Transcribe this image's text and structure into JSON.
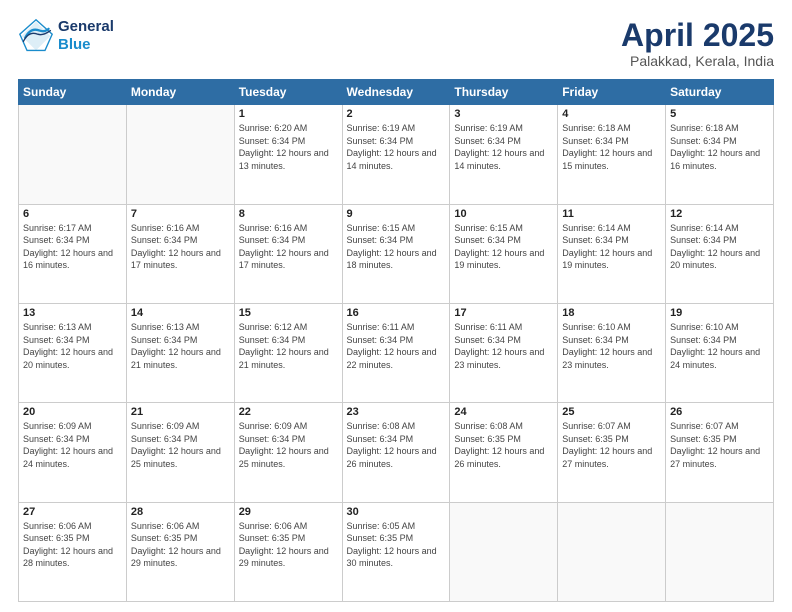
{
  "header": {
    "logo_line1": "General",
    "logo_line2": "Blue",
    "title": "April 2025",
    "subtitle": "Palakkad, Kerala, India"
  },
  "days_of_week": [
    "Sunday",
    "Monday",
    "Tuesday",
    "Wednesday",
    "Thursday",
    "Friday",
    "Saturday"
  ],
  "weeks": [
    [
      {
        "day": "",
        "info": ""
      },
      {
        "day": "",
        "info": ""
      },
      {
        "day": "1",
        "info": "Sunrise: 6:20 AM\nSunset: 6:34 PM\nDaylight: 12 hours and 13 minutes."
      },
      {
        "day": "2",
        "info": "Sunrise: 6:19 AM\nSunset: 6:34 PM\nDaylight: 12 hours and 14 minutes."
      },
      {
        "day": "3",
        "info": "Sunrise: 6:19 AM\nSunset: 6:34 PM\nDaylight: 12 hours and 14 minutes."
      },
      {
        "day": "4",
        "info": "Sunrise: 6:18 AM\nSunset: 6:34 PM\nDaylight: 12 hours and 15 minutes."
      },
      {
        "day": "5",
        "info": "Sunrise: 6:18 AM\nSunset: 6:34 PM\nDaylight: 12 hours and 16 minutes."
      }
    ],
    [
      {
        "day": "6",
        "info": "Sunrise: 6:17 AM\nSunset: 6:34 PM\nDaylight: 12 hours and 16 minutes."
      },
      {
        "day": "7",
        "info": "Sunrise: 6:16 AM\nSunset: 6:34 PM\nDaylight: 12 hours and 17 minutes."
      },
      {
        "day": "8",
        "info": "Sunrise: 6:16 AM\nSunset: 6:34 PM\nDaylight: 12 hours and 17 minutes."
      },
      {
        "day": "9",
        "info": "Sunrise: 6:15 AM\nSunset: 6:34 PM\nDaylight: 12 hours and 18 minutes."
      },
      {
        "day": "10",
        "info": "Sunrise: 6:15 AM\nSunset: 6:34 PM\nDaylight: 12 hours and 19 minutes."
      },
      {
        "day": "11",
        "info": "Sunrise: 6:14 AM\nSunset: 6:34 PM\nDaylight: 12 hours and 19 minutes."
      },
      {
        "day": "12",
        "info": "Sunrise: 6:14 AM\nSunset: 6:34 PM\nDaylight: 12 hours and 20 minutes."
      }
    ],
    [
      {
        "day": "13",
        "info": "Sunrise: 6:13 AM\nSunset: 6:34 PM\nDaylight: 12 hours and 20 minutes."
      },
      {
        "day": "14",
        "info": "Sunrise: 6:13 AM\nSunset: 6:34 PM\nDaylight: 12 hours and 21 minutes."
      },
      {
        "day": "15",
        "info": "Sunrise: 6:12 AM\nSunset: 6:34 PM\nDaylight: 12 hours and 21 minutes."
      },
      {
        "day": "16",
        "info": "Sunrise: 6:11 AM\nSunset: 6:34 PM\nDaylight: 12 hours and 22 minutes."
      },
      {
        "day": "17",
        "info": "Sunrise: 6:11 AM\nSunset: 6:34 PM\nDaylight: 12 hours and 23 minutes."
      },
      {
        "day": "18",
        "info": "Sunrise: 6:10 AM\nSunset: 6:34 PM\nDaylight: 12 hours and 23 minutes."
      },
      {
        "day": "19",
        "info": "Sunrise: 6:10 AM\nSunset: 6:34 PM\nDaylight: 12 hours and 24 minutes."
      }
    ],
    [
      {
        "day": "20",
        "info": "Sunrise: 6:09 AM\nSunset: 6:34 PM\nDaylight: 12 hours and 24 minutes."
      },
      {
        "day": "21",
        "info": "Sunrise: 6:09 AM\nSunset: 6:34 PM\nDaylight: 12 hours and 25 minutes."
      },
      {
        "day": "22",
        "info": "Sunrise: 6:09 AM\nSunset: 6:34 PM\nDaylight: 12 hours and 25 minutes."
      },
      {
        "day": "23",
        "info": "Sunrise: 6:08 AM\nSunset: 6:34 PM\nDaylight: 12 hours and 26 minutes."
      },
      {
        "day": "24",
        "info": "Sunrise: 6:08 AM\nSunset: 6:35 PM\nDaylight: 12 hours and 26 minutes."
      },
      {
        "day": "25",
        "info": "Sunrise: 6:07 AM\nSunset: 6:35 PM\nDaylight: 12 hours and 27 minutes."
      },
      {
        "day": "26",
        "info": "Sunrise: 6:07 AM\nSunset: 6:35 PM\nDaylight: 12 hours and 27 minutes."
      }
    ],
    [
      {
        "day": "27",
        "info": "Sunrise: 6:06 AM\nSunset: 6:35 PM\nDaylight: 12 hours and 28 minutes."
      },
      {
        "day": "28",
        "info": "Sunrise: 6:06 AM\nSunset: 6:35 PM\nDaylight: 12 hours and 29 minutes."
      },
      {
        "day": "29",
        "info": "Sunrise: 6:06 AM\nSunset: 6:35 PM\nDaylight: 12 hours and 29 minutes."
      },
      {
        "day": "30",
        "info": "Sunrise: 6:05 AM\nSunset: 6:35 PM\nDaylight: 12 hours and 30 minutes."
      },
      {
        "day": "",
        "info": ""
      },
      {
        "day": "",
        "info": ""
      },
      {
        "day": "",
        "info": ""
      }
    ]
  ]
}
